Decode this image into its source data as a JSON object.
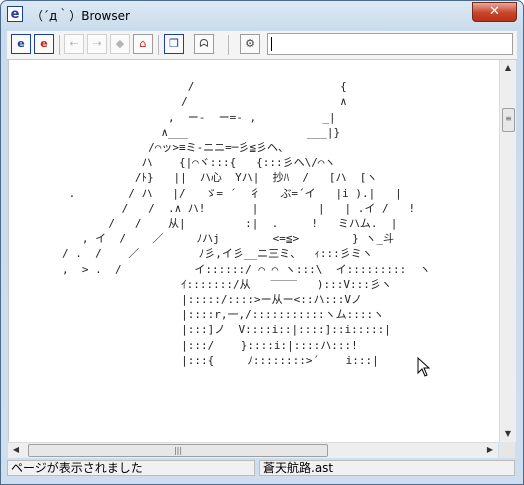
{
  "window": {
    "title": "（´д｀）Browser",
    "app_icon": "e",
    "close": "✕"
  },
  "toolbar": {
    "buttons": [
      {
        "name": "open-file-button",
        "glyph": "e"
      },
      {
        "name": "open-url-button",
        "glyph": "e"
      },
      {
        "name": "back-button",
        "glyph": "⇠"
      },
      {
        "name": "forward-button",
        "glyph": "⇢"
      },
      {
        "name": "stop-button",
        "glyph": "◆"
      },
      {
        "name": "home-button",
        "glyph": "⌂"
      },
      {
        "name": "copy-button",
        "glyph": "❐"
      },
      {
        "name": "face-button",
        "glyph": "ᗣ"
      },
      {
        "name": "settings-button",
        "glyph": "⚙"
      }
    ],
    "address_value": ""
  },
  "content": {
    "ascii_art": "\n                           /                      {\n                          /                       ∧\n                        ,  ー-  ー=- ,          _|\n                       ∧___                  ___|}\n                     /⌒ッ>≡ミ-ニニ=─彡≦彡ヘ、\n                    ハ    {|⌒ヾ:::{   {:::彡ヘ\\/⌒ヽ\n                   /ﾄ}   ||  ハ心  Yハ|  抄ﾊ  /   [ハ  [ヽ\n         .        / ハ   |/   ゞ= ´  彳   ぶ=´イ   |i ).|   |\n                 /   /  .∧ ハ!       |         |   | .イ /   !\n               /   /    从|         :|  .     !   ミハム.  |\n           , イ  /    ／     ﾉハj        <=≦>        } ヽ_斗\n        / .  /    ／         ﾉ彡,イ彡__ニ三ミ、  ｨ:::彡ミヽ\n        ,  > .  /           イ::::::/ ⌒ ⌒ ヽ:::\\  イ:::::::::  ヽ\n                          ｲ:::::::/从   ‾‾‾‾   ):::V:::彡ヽ\n                          |:::::/::::>ー从ー<::ハ:::Vノ\n                          |::::r,一,/:::::::::::ヽム::::ヽ\n                          |:::]ノ  V::::i::|::::]::i:::::|\n                          |:::/    }::::i:|::::ハ:::!\n                          |:::{     ﾉ::::::::>´    i:::|",
    "status_left": "ページが表示されました",
    "status_right": "蒼天航路.ast"
  },
  "scroll": {
    "up": "▲",
    "down": "▼",
    "left": "◀",
    "right": "▶",
    "grip_v": "≡",
    "grip_h": "|||"
  }
}
